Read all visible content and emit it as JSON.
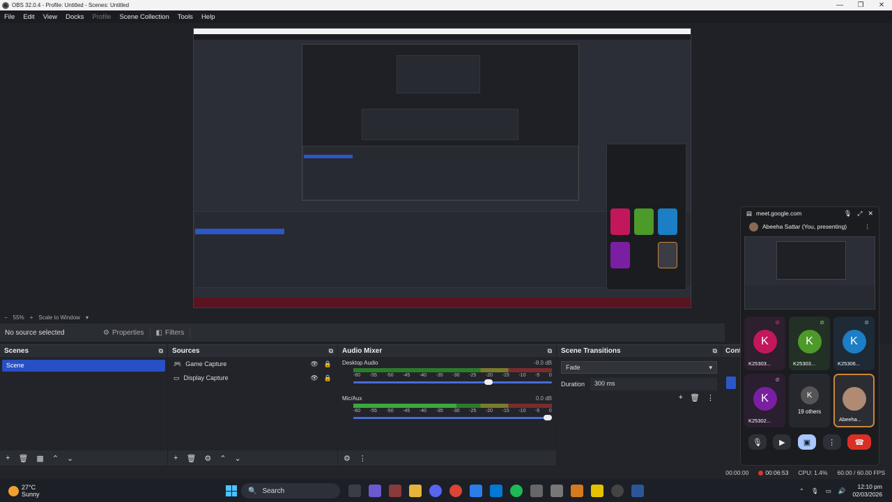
{
  "window": {
    "title": "OBS 32.0.4 - Profile: Untitled - Scenes: Untitled",
    "minimize": "—",
    "maximize": "❐",
    "close": "✕"
  },
  "menu": [
    "File",
    "Edit",
    "View",
    "Docks",
    "Profile",
    "Scene Collection",
    "Tools",
    "Help"
  ],
  "zoom": {
    "value": "55%",
    "mode": "Scale to Window"
  },
  "source_bar": {
    "label": "No source selected",
    "properties": "Properties",
    "filters": "Filters"
  },
  "scenes": {
    "title": "Scenes",
    "items": [
      "Scene"
    ]
  },
  "sources": {
    "title": "Sources",
    "items": [
      "Game Capture",
      "Display Capture"
    ]
  },
  "mixer": {
    "title": "Audio Mixer",
    "channels": [
      {
        "name": "Desktop Audio",
        "db": "-8.0 dB",
        "volume": 0.7
      },
      {
        "name": "Mic/Aux",
        "db": "0.0 dB",
        "volume": 1.0
      }
    ],
    "ticks": [
      "-60",
      "-55",
      "-50",
      "-45",
      "-40",
      "-35",
      "-30",
      "-25",
      "-20",
      "-15",
      "-10",
      "-5",
      "0"
    ]
  },
  "transitions": {
    "title": "Scene Transitions",
    "selected": "Fade",
    "duration_label": "Duration",
    "duration": "300 ms"
  },
  "controls": {
    "title": "Cont"
  },
  "status": {
    "stream_time": "00:00:00",
    "rec_time": "00:06:53",
    "cpu": "CPU: 1.4%",
    "fps": "60.00 / 60.00 FPS"
  },
  "meet": {
    "host": "meet.google.com",
    "presenting": "Abeeha Sattar (You, presenting)",
    "tiles": [
      {
        "letter": "K",
        "name": "K25303...",
        "color": "#c2185b"
      },
      {
        "letter": "K",
        "name": "K25303...",
        "color": "#4c9a2a"
      },
      {
        "letter": "K",
        "name": "K25306...",
        "color": "#1c7ec4"
      },
      {
        "letter": "K",
        "name": "K25302...",
        "color": "#7b1fa2"
      },
      {
        "letter": "K",
        "name": "19 others",
        "color": "#3a3d44"
      },
      {
        "letter": "",
        "name": "Abeeha...",
        "color": "#3a3d44"
      }
    ]
  },
  "taskbar": {
    "temp": "27°C",
    "weather": "Sunny",
    "search": "Search",
    "time": "12:10 pm",
    "date": "02/03/2026"
  }
}
